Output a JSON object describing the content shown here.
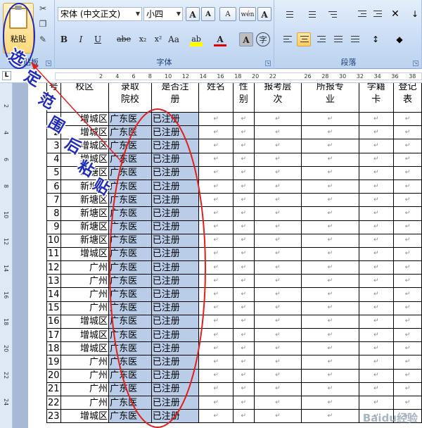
{
  "ribbon": {
    "clipboard": {
      "paste_label": "粘贴",
      "group_label": "剪贴板"
    },
    "font": {
      "font_name": "宋体 (中文正文)",
      "font_size": "小四",
      "group_label": "字体",
      "buttons": {
        "bold": "B",
        "italic": "I",
        "underline": "U",
        "strike": "abe",
        "subscript": "x₂",
        "superscript": "x²",
        "case": "Aa",
        "grow": "A",
        "shrink": "A",
        "clear": "A",
        "highlight": "ab",
        "color": "A",
        "charshade": "A",
        "phonetic": "wén",
        "enclose": "字"
      }
    },
    "paragraph": {
      "group_label": "段落"
    }
  },
  "ruler": {
    "corner": "L",
    "numbers": [
      "2",
      "4",
      "6",
      "8",
      "10",
      "12",
      "14",
      "16",
      "18",
      "20",
      "22",
      "26",
      "28",
      "30",
      "32",
      "34",
      "36",
      "38"
    ],
    "vnumbers": [
      "2",
      "4",
      "6",
      "8",
      "10",
      "12",
      "14",
      "16",
      "18",
      "20",
      "22",
      "24"
    ]
  },
  "table": {
    "headers": [
      "号",
      "校区",
      "录取院校",
      "是否注册",
      "姓名",
      "性别",
      "报考层次",
      "所报专业",
      "学籍卡",
      "登记表"
    ],
    "header_lines": [
      [
        "号"
      ],
      [
        "校区"
      ],
      [
        "录取",
        "院校"
      ],
      [
        "是否注",
        "册"
      ],
      [
        "姓名"
      ],
      [
        "性",
        "别"
      ],
      [
        "报考层",
        "次"
      ],
      [
        "所报专",
        "业"
      ],
      [
        "学籍",
        "卡"
      ],
      [
        "登记",
        "表"
      ]
    ],
    "mark": "↵",
    "rows": [
      {
        "no": "1",
        "campus": "增城区",
        "school": "广东医",
        "reg": "已注册"
      },
      {
        "no": "2",
        "campus": "增城区",
        "school": "广东医",
        "reg": "已注册"
      },
      {
        "no": "3",
        "campus": "增城区",
        "school": "广东医",
        "reg": "已注册"
      },
      {
        "no": "4",
        "campus": "增城区",
        "school": "广东医",
        "reg": "已注册"
      },
      {
        "no": "5",
        "campus": "新塘区",
        "school": "广东医",
        "reg": "已注册"
      },
      {
        "no": "6",
        "campus": "新塘区",
        "school": "广东医",
        "reg": "已注册"
      },
      {
        "no": "7",
        "campus": "新塘区",
        "school": "广东医",
        "reg": "已注册"
      },
      {
        "no": "8",
        "campus": "新塘区",
        "school": "广东医",
        "reg": "已注册"
      },
      {
        "no": "9",
        "campus": "新塘区",
        "school": "广东医",
        "reg": "已注册"
      },
      {
        "no": "10",
        "campus": "新塘区",
        "school": "广东医",
        "reg": "已注册"
      },
      {
        "no": "11",
        "campus": "增城区",
        "school": "广东医",
        "reg": "已注册"
      },
      {
        "no": "12",
        "campus": "广州",
        "school": "广东医",
        "reg": "已注册"
      },
      {
        "no": "13",
        "campus": "广州",
        "school": "广东医",
        "reg": "已注册"
      },
      {
        "no": "14",
        "campus": "广州",
        "school": "广东医",
        "reg": "已注册"
      },
      {
        "no": "15",
        "campus": "广州",
        "school": "广东医",
        "reg": "已注册"
      },
      {
        "no": "16",
        "campus": "增城区",
        "school": "广东医",
        "reg": "已注册"
      },
      {
        "no": "17",
        "campus": "增城区",
        "school": "广东医",
        "reg": "已注册"
      },
      {
        "no": "18",
        "campus": "增城区",
        "school": "广东医",
        "reg": "已注册"
      },
      {
        "no": "19",
        "campus": "广州",
        "school": "广东医",
        "reg": "已注册"
      },
      {
        "no": "20",
        "campus": "广州",
        "school": "广东医",
        "reg": "已注册"
      },
      {
        "no": "21",
        "campus": "广州",
        "school": "广东医",
        "reg": "已注册"
      },
      {
        "no": "22",
        "campus": "广州",
        "school": "广东医",
        "reg": "已注册"
      },
      {
        "no": "23",
        "campus": "增城区",
        "school": "广东医",
        "reg": "已注册"
      }
    ]
  },
  "annotation": {
    "chars": [
      "选",
      "定",
      "范",
      "围",
      "后",
      "粘",
      "贴"
    ],
    "color": "#1f2bb8",
    "ellipse_color": "#e02020",
    "selection_color": "#b9cce8"
  },
  "watermark": "Baidu经验"
}
